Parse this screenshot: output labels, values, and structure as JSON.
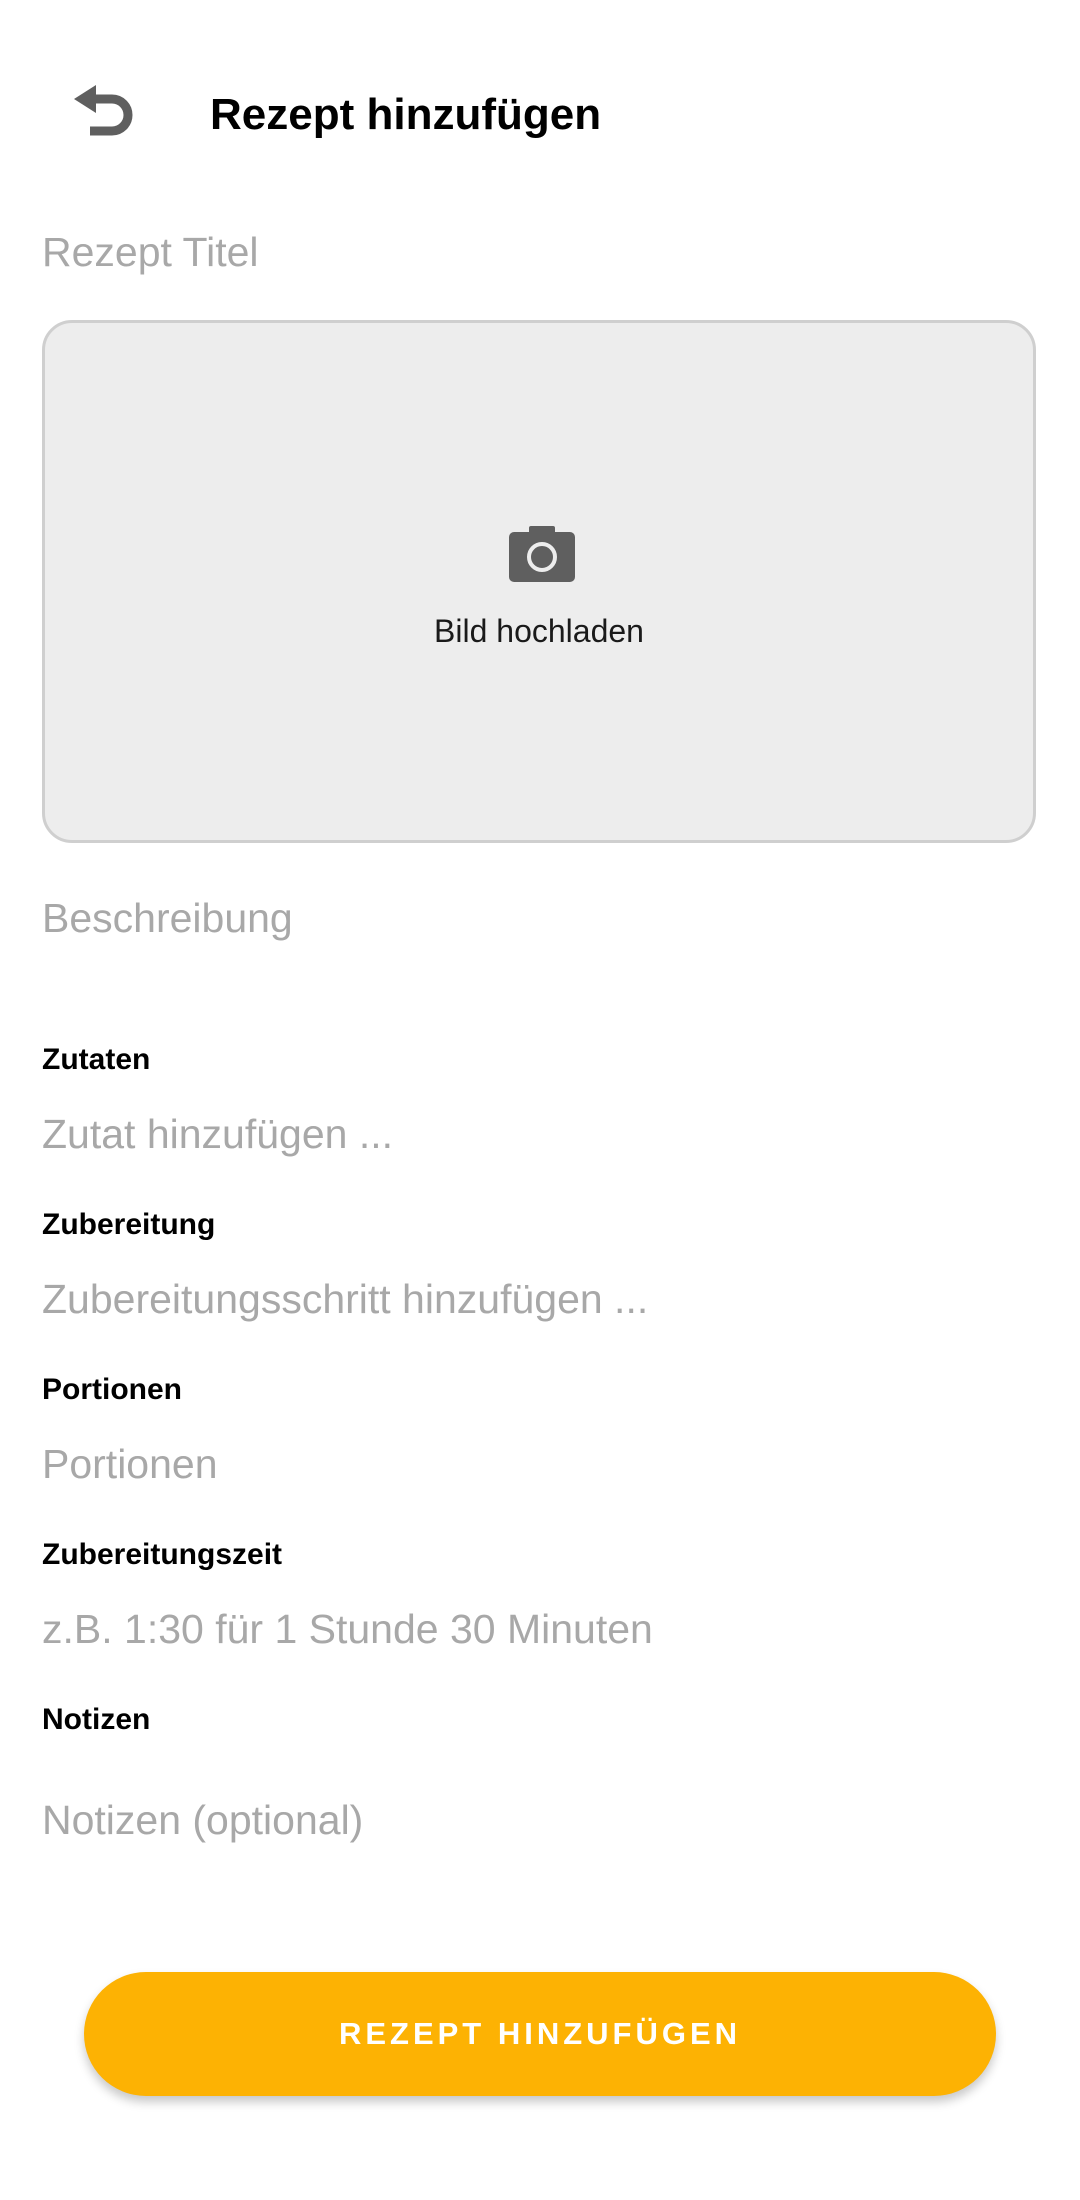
{
  "header": {
    "back_icon": "undo-arrow-icon",
    "title": "Rezept hinzufügen"
  },
  "form": {
    "title_placeholder": "Rezept Titel",
    "image_upload": {
      "icon": "camera-icon",
      "label": "Bild hochladen"
    },
    "description_placeholder": "Beschreibung",
    "ingredients": {
      "label": "Zutaten",
      "placeholder": "Zutat hinzufügen ..."
    },
    "preparation": {
      "label": "Zubereitung",
      "placeholder": "Zubereitungsschritt hinzufügen ..."
    },
    "portions": {
      "label": "Portionen",
      "placeholder": "Portionen"
    },
    "prep_time": {
      "label": "Zubereitungszeit",
      "placeholder": "z.B. 1:30 für 1 Stunde 30 Minuten"
    },
    "notes": {
      "label": "Notizen",
      "placeholder": "Notizen (optional)"
    }
  },
  "submit_button": {
    "label": "REZEPT HINZUFÜGEN"
  },
  "colors": {
    "accent": "#fdb203",
    "placeholder": "#a8a8a8",
    "upload_background": "#ededed",
    "icon_gray": "#5f5f5f"
  }
}
